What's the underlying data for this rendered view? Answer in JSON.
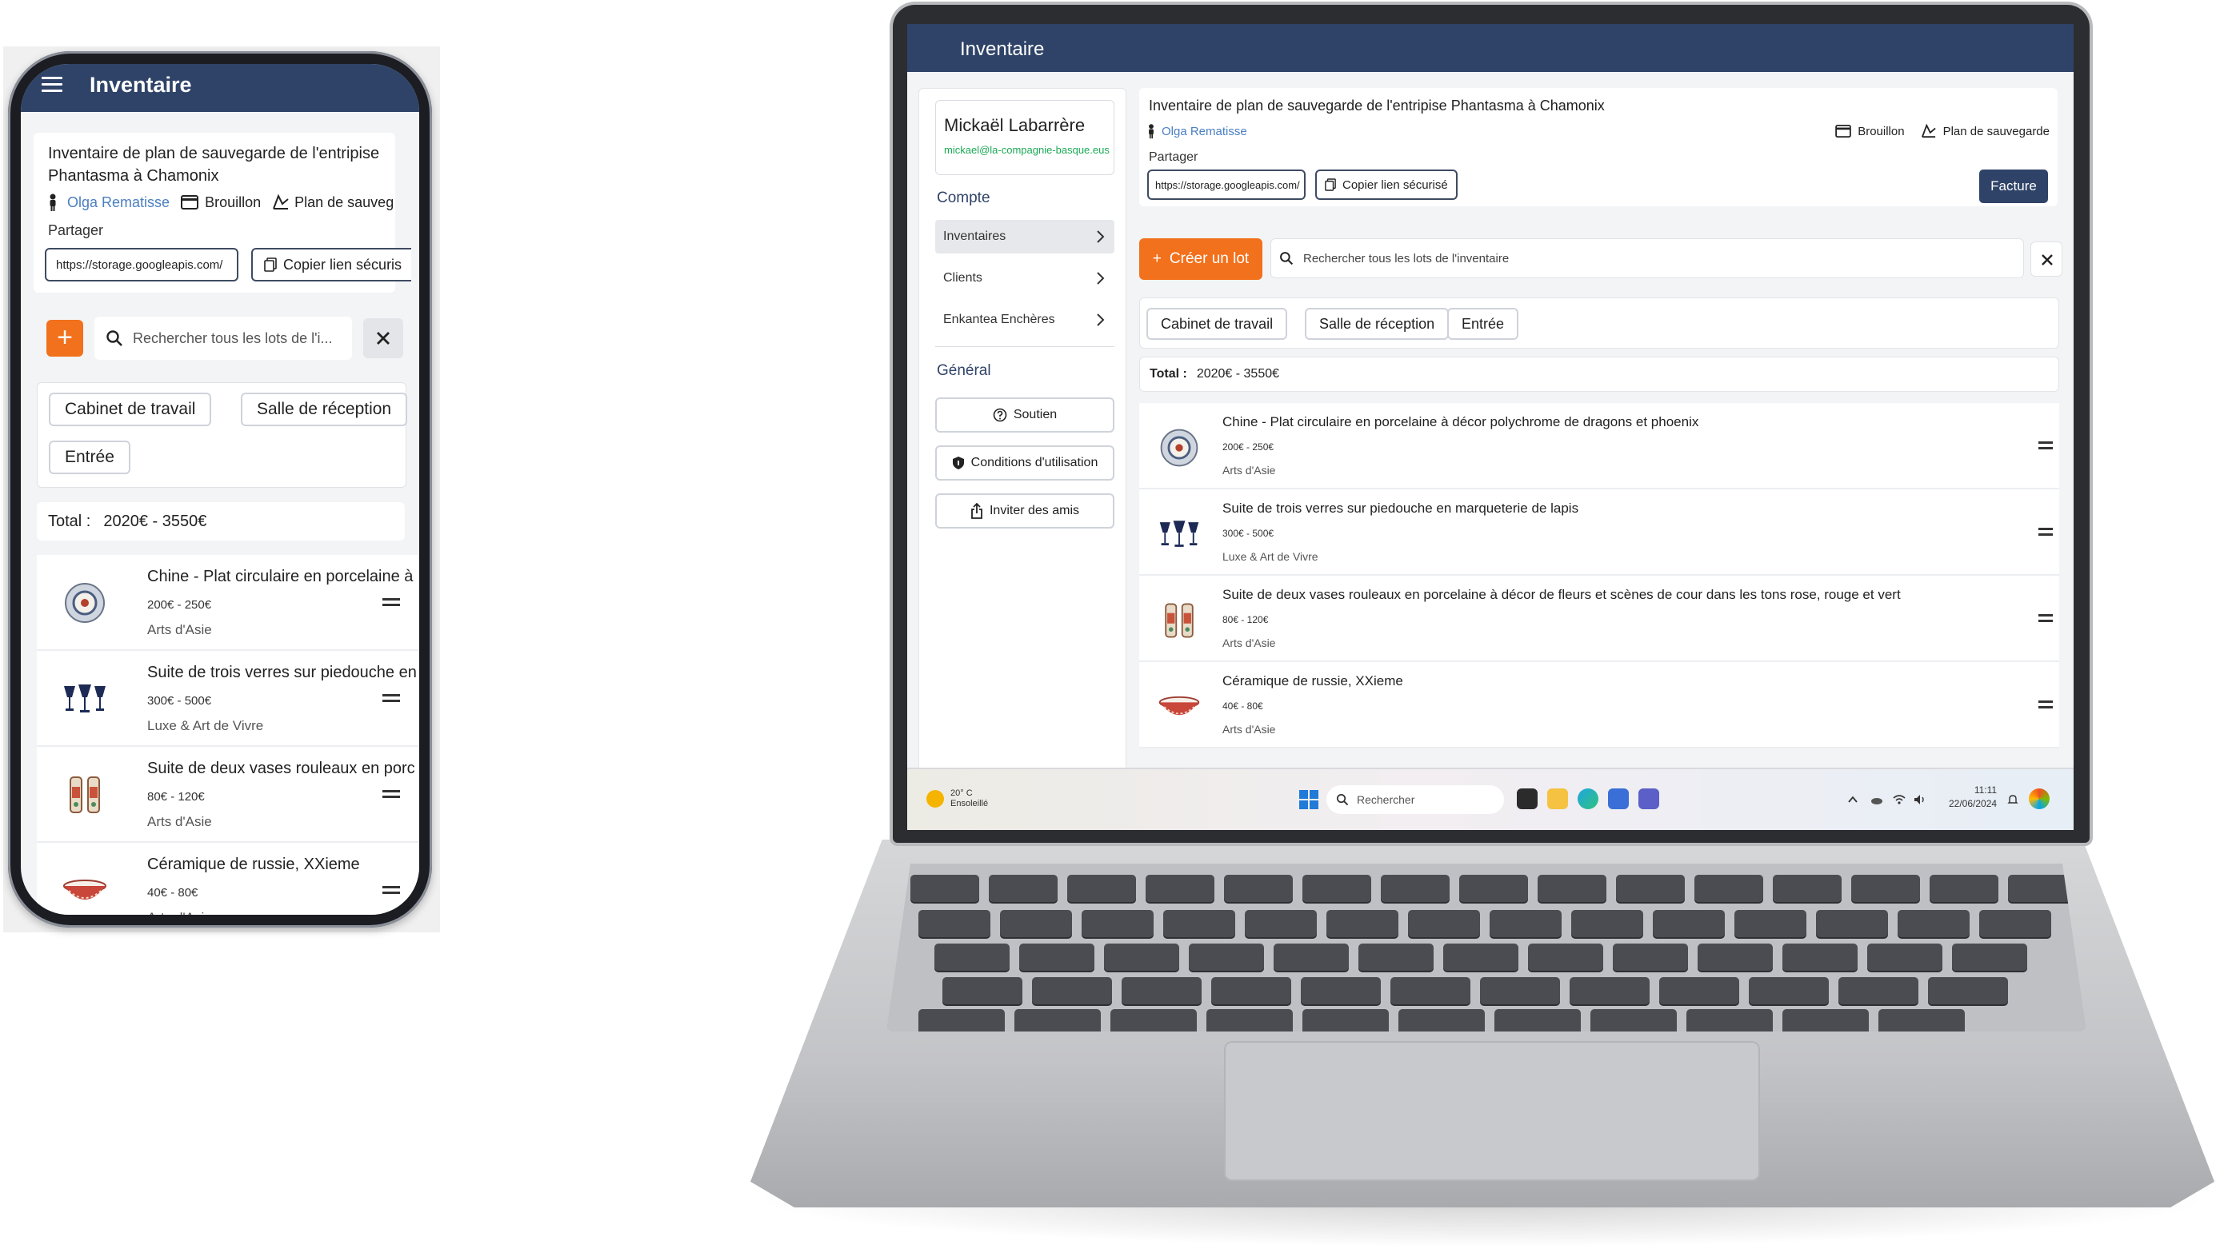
{
  "app": {
    "title": "Inventaire",
    "inventory_title": "Inventaire de plan de sauvegarde de l'entripise Phantasma à Chamonix",
    "owner": "Olga Rematisse",
    "status": "Brouillon",
    "plan_type_full": "Plan de sauvegarde",
    "plan_type_truncated": "Plan de sauveg",
    "share_label": "Partager",
    "share_url": "https://storage.googleapis.com/",
    "copy_label_full": "Copier lien sécurisé",
    "copy_label_truncated": "Copier lien sécuris",
    "invoice_label": "Facture",
    "create_label": "Créer un lot",
    "add_symbol": "+",
    "search_placeholder_full": "Rechercher tous les lots de l'inventaire",
    "search_placeholder_truncated": "Rechercher tous les lots de l'i...",
    "rooms": [
      "Cabinet de travail",
      "Salle de réception",
      "Entrée"
    ],
    "total_label": "Total :",
    "total_value": "2020€ - 3550€"
  },
  "items": [
    {
      "title": "Chine - Plat circulaire en porcelaine à décor polychrome de dragons et phoenix",
      "title_mobile": "Chine - Plat circulaire en porcelaine à",
      "price": "200€ - 250€",
      "category": "Arts d'Asie",
      "thumb": "plate-thumbnail"
    },
    {
      "title": "Suite de trois verres sur piedouche en marqueterie de lapis",
      "title_mobile": "Suite de trois verres sur piedouche en",
      "price": "300€ - 500€",
      "category": "Luxe & Art de Vivre",
      "thumb": "glasses-thumbnail"
    },
    {
      "title": "Suite de deux vases rouleaux en porcelaine à décor de fleurs et scènes de cour dans les tons rose, rouge et vert",
      "title_mobile": "Suite de deux vases rouleaux en porc",
      "price": "80€ - 120€",
      "category": "Arts d'Asie",
      "thumb": "vases-thumbnail"
    },
    {
      "title": "Céramique de russie, XXieme",
      "title_mobile": "Céramique de russie, XXieme",
      "price": "40€ - 80€",
      "category": "Arts d'Asie",
      "thumb": "bowl-thumbnail"
    }
  ],
  "sidebar": {
    "user_name": "Mickaël Labarrère",
    "user_email": "mickael@la-compagnie-basque.eus",
    "section_account": "Compte",
    "nav": [
      {
        "label": "Inventaires",
        "active": true
      },
      {
        "label": "Clients",
        "active": false
      },
      {
        "label": "Enkantea Enchères",
        "active": false
      }
    ],
    "section_general": "Général",
    "buttons": [
      "Soutien",
      "Conditions d'utilisation",
      "Inviter des amis"
    ]
  },
  "taskbar": {
    "temperature": "20° C",
    "weather": "Ensoleillé",
    "search_placeholder": "Rechercher",
    "time": "11:11",
    "date": "22/06/2024"
  },
  "colors": {
    "topbar": "#2f4368",
    "accent_orange": "#f2711c",
    "link_blue": "#4a7fc1",
    "email_green": "#1aaa55"
  }
}
